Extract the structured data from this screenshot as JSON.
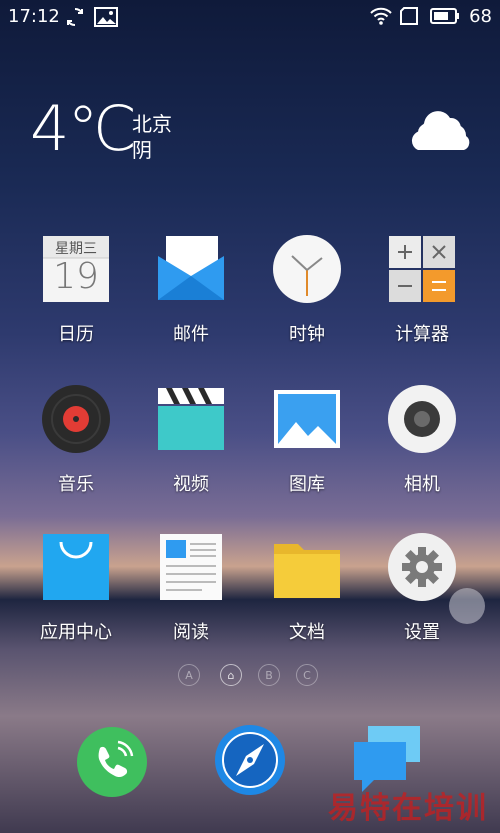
{
  "status_bar": {
    "time": "17:12",
    "battery_percent": "68"
  },
  "weather": {
    "temperature": "4℃",
    "city": "北京",
    "condition": "阴"
  },
  "apps": [
    {
      "label": "日历",
      "icon": "calendar-icon",
      "calendar_weekday": "星期三",
      "calendar_day": "19"
    },
    {
      "label": "邮件",
      "icon": "mail-icon"
    },
    {
      "label": "时钟",
      "icon": "clock-icon"
    },
    {
      "label": "计算器",
      "icon": "calculator-icon"
    },
    {
      "label": "音乐",
      "icon": "music-icon"
    },
    {
      "label": "视频",
      "icon": "video-icon"
    },
    {
      "label": "图库",
      "icon": "gallery-icon"
    },
    {
      "label": "相机",
      "icon": "camera-icon"
    },
    {
      "label": "应用中心",
      "icon": "app-store-icon"
    },
    {
      "label": "阅读",
      "icon": "reading-icon"
    },
    {
      "label": "文档",
      "icon": "folder-icon"
    },
    {
      "label": "设置",
      "icon": "settings-icon"
    }
  ],
  "page_indicators": [
    "A",
    "⌂",
    "B",
    "C"
  ],
  "dock": [
    {
      "icon": "phone-icon"
    },
    {
      "icon": "browser-compass-icon"
    },
    {
      "icon": "messages-icon"
    }
  ],
  "watermark": "易特在培训"
}
